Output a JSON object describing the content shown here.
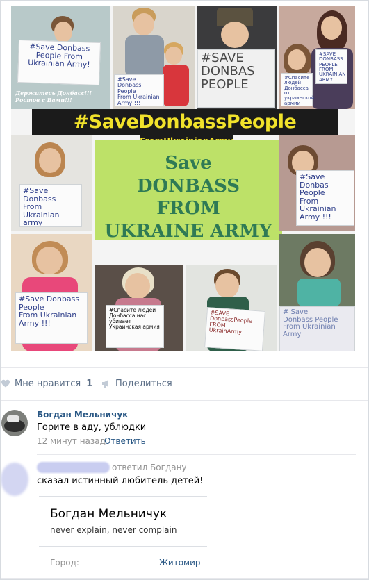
{
  "post": {
    "collage": {
      "banner_title": "#SaveDonbassPeople",
      "banner_subtitle": "FromUkrainianArmy",
      "center_sign_text": "Save\nDONBASS\nFROM\nUKRAINE ARMY",
      "caption_left": "Держитесь Донбасс!!! Ростов с Вами!!!",
      "signs": [
        "#Save Donbass\nPeople From\nUkrainian Army!",
        "#Save Donbass\nPeople\nFrom Ukrainian\nArmy !!!",
        "#SAVE\nDONBAS\nPEOPLE",
        "#Спасите\nлюдей\nДонбасса\nот\nукраинской\nармии",
        "#SAVE\nDONBASS\nPEOPLE\nFROM UKRAINIAN\nARMY",
        "#Save\nDonbass\nFrom Ukrainian\narmy",
        "#Save Donbas\nPeople\nFrom Ukrainian\nArmy !!!",
        "#Save Donbass\nPeople\nFrom Ukrainian\nArmy !!!",
        "#Спасите людей\nДонбасса нас\nубивает\nУкраинская армия",
        "#SAVE\nDonbassPeople\nFROM\nUkrainArmy",
        "# Save\nDonbass People\nFrom Ukrainian Army"
      ]
    },
    "actions": {
      "like_label": "Мне нравится",
      "like_count": "1",
      "share_label": "Поделиться"
    }
  },
  "comments": [
    {
      "author": "Богдан Мельничук",
      "text": "Горите в аду, ублюдки",
      "time": "12 минут назад",
      "reply_label": "Ответить"
    },
    {
      "reply_to": "ответил Богдану",
      "text": "сказал истинный любитель детей!"
    }
  ],
  "profile_card": {
    "name": "Богдан Мельничук",
    "status": "never explain, never complain",
    "city_label": "Город:",
    "city_value": "Житомир"
  },
  "colors": {
    "link": "#2a5885",
    "muted": "#939393",
    "banner_text": "#f1e22b",
    "banner_bg": "#1b1b1b"
  }
}
